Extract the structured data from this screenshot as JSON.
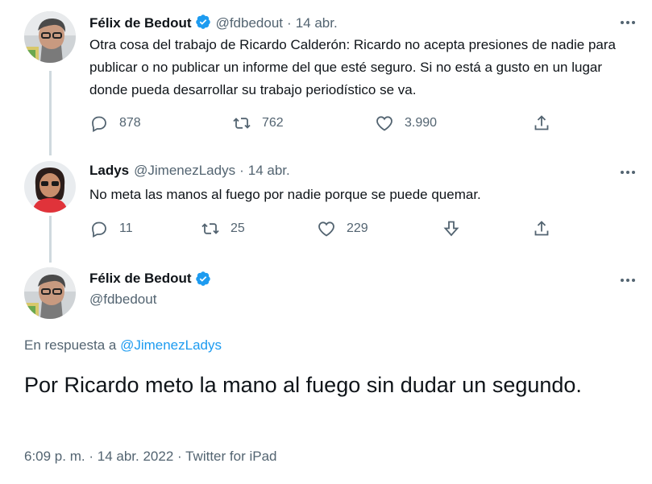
{
  "tweets": [
    {
      "name": "Félix de Bedout",
      "verified": true,
      "handle": "@fdbedout",
      "date": "14 abr.",
      "text": "Otra cosa del trabajo de Ricardo Calderón: Ricardo no acepta presiones de nadie para publicar o no publicar un informe del que esté seguro. Si no está a gusto en un lugar donde pueda desarrollar su trabajo periodístico se va.",
      "replies": "878",
      "retweets": "762",
      "likes": "3.990"
    },
    {
      "name": "Ladys",
      "verified": false,
      "handle": "@JimenezLadys",
      "date": "14 abr.",
      "text": "No meta las manos al fuego por nadie porque se puede quemar.",
      "replies": "11",
      "retweets": "25",
      "likes": "229"
    }
  ],
  "main": {
    "name": "Félix de Bedout",
    "handle": "@fdbedout",
    "reply_prefix": "En respuesta a ",
    "reply_handle": "@JimenezLadys",
    "text": "Por Ricardo meto la mano al fuego sin dudar un segundo.",
    "time": "6:09 p. m.",
    "date": "14 abr. 2022",
    "source": "Twitter for iPad"
  },
  "separator": "·",
  "colors": {
    "accent": "#1d9bf0",
    "secondary_text": "#536471",
    "primary_text": "#0f1419",
    "thread_line": "#cfd9de"
  },
  "icons": [
    "reply-icon",
    "retweet-icon",
    "like-icon",
    "share-icon",
    "downvote-icon",
    "more-icon",
    "verified-badge-icon"
  ]
}
